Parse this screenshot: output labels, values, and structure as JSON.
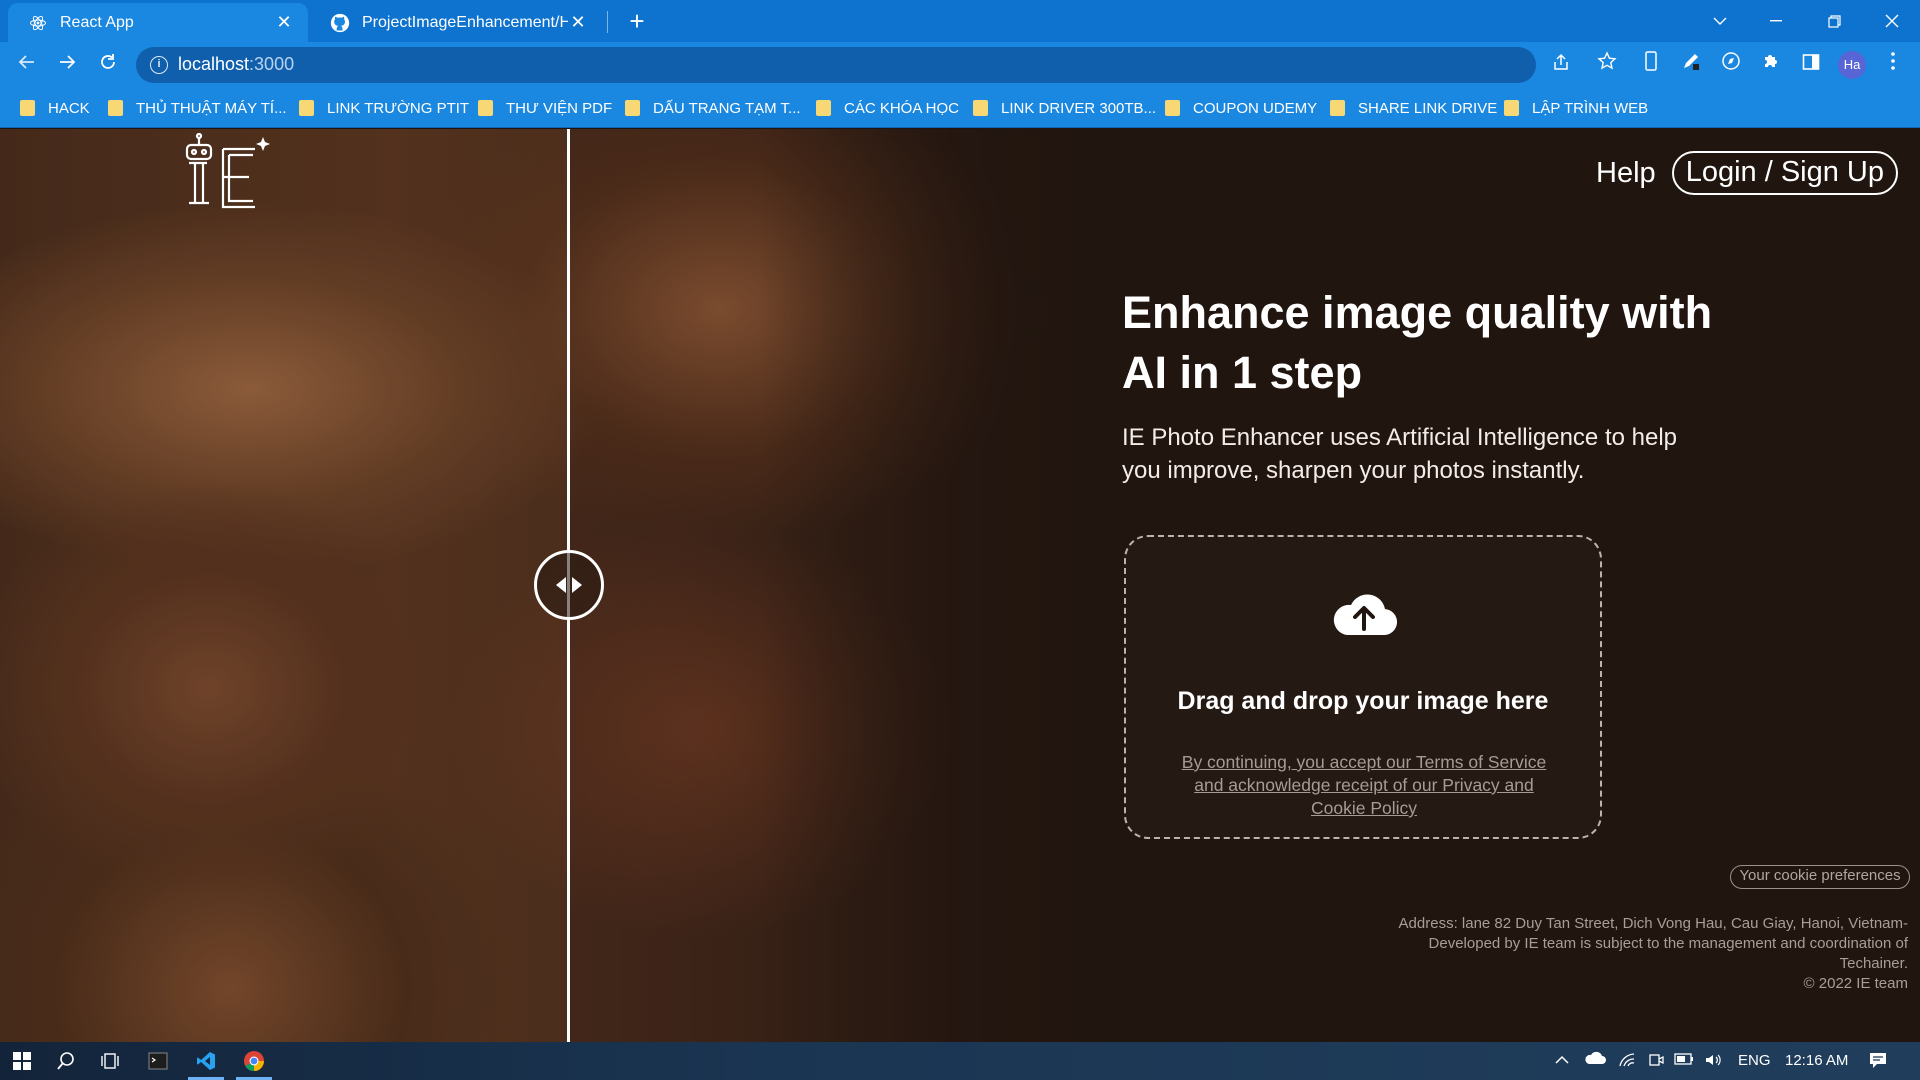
{
  "browser": {
    "tabs": [
      {
        "title": "React App",
        "icon": "react-icon",
        "active": true
      },
      {
        "title": "ProjectImageEnhancement/Hom",
        "icon": "github-icon",
        "active": false
      }
    ],
    "url_host": "localhost",
    "url_port": ":3000",
    "profile_initials": "Ha",
    "bookmarks": [
      "HACK",
      "THỦ THUẬT MÁY TÍ...",
      "LINK TRƯỜNG PTIT",
      "THƯ VIỆN PDF",
      "DẤU TRANG TẠM T...",
      "CÁC KHÓA HỌC",
      "LINK DRIVER 300TB...",
      "COUPON UDEMY",
      "SHARE LINK DRIVE",
      "LẬP TRÌNH WEB"
    ],
    "bookmark_color": "#f8d775",
    "accent": "#1a87e0"
  },
  "app": {
    "logo_text": "IE",
    "nav": {
      "help": "Help",
      "login": "Login / Sign Up"
    },
    "hero": {
      "title_line1": "Enhance image quality with",
      "title_line2": "AI in 1 step",
      "subtitle_line1": "IE Photo Enhancer uses Artificial Intelligence to help",
      "subtitle_line2": "you improve, sharpen your photos instantly."
    },
    "compare_slider_position": 0.295,
    "dropzone": {
      "title": "Drag and drop your image here",
      "terms_line1": "By continuing, you accept our Terms of Service",
      "terms_line2": "and acknowledge receipt of our Privacy and",
      "terms_line3": "Cookie Policy"
    },
    "cookie_button": "Your cookie preferences",
    "footer": {
      "line1": "Address: lane 82 Duy Tan Street, Dich Vong Hau, Cau Giay, Hanoi, Vietnam-",
      "line2": "Developed by IE team is subject to the management and coordination of",
      "line3": "Techainer.",
      "line4": "© 2022 IE team"
    },
    "background_color": "#21150f"
  },
  "taskbar": {
    "language": "ENG",
    "time": "12:16 AM"
  }
}
